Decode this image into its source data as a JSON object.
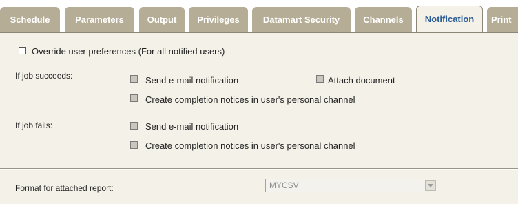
{
  "tabs": [
    {
      "label": "Schedule",
      "active": false
    },
    {
      "label": "Parameters",
      "active": false
    },
    {
      "label": "Output",
      "active": false
    },
    {
      "label": "Privileges",
      "active": false
    },
    {
      "label": "Datamart Security",
      "active": false
    },
    {
      "label": "Channels",
      "active": false
    },
    {
      "label": "Notification",
      "active": true
    },
    {
      "label": "Print",
      "active": false
    }
  ],
  "notification": {
    "override_label": "Override user preferences (For all notified users)",
    "override_checked": false,
    "success": {
      "heading": "If job succeeds:",
      "send_email_label": "Send e-mail notification",
      "send_email_checked": false,
      "attach_document_label": "Attach document",
      "attach_document_checked": false,
      "completion_notice_label": "Create completion notices in user's personal channel",
      "completion_notice_checked": false
    },
    "failure": {
      "heading": "If job fails:",
      "send_email_label": "Send e-mail notification",
      "send_email_checked": false,
      "completion_notice_label": "Create completion notices in user's personal channel",
      "completion_notice_checked": false
    },
    "format": {
      "label": "Format for attached report:",
      "selected": "MYCSV",
      "disabled": true
    }
  },
  "colors": {
    "tab_inactive": "#b5ad96",
    "tab_active_bg": "#f4f1e8",
    "tab_active_text": "#2d5d95",
    "panel_bg": "#f4f1e8"
  }
}
